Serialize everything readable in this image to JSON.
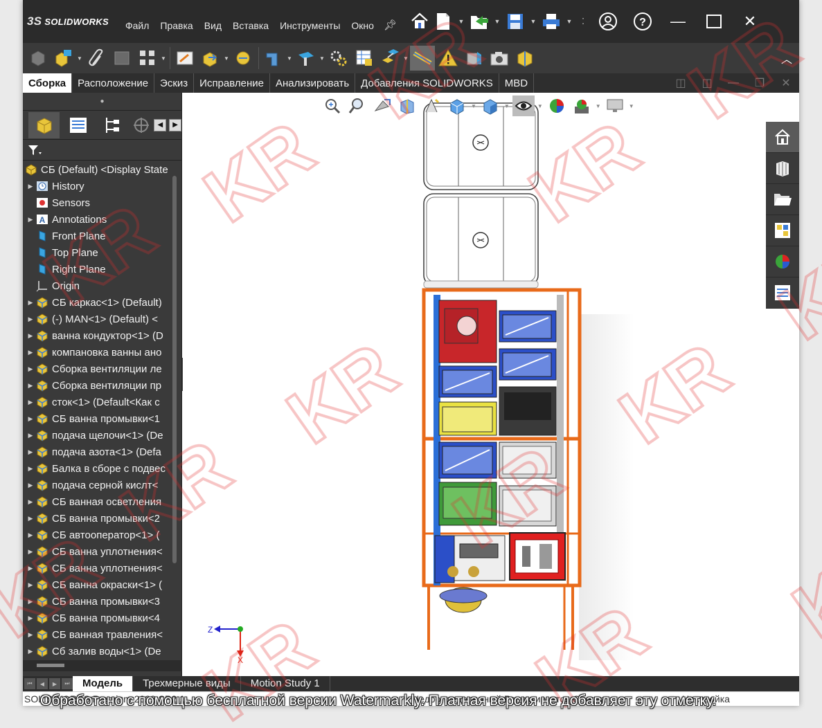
{
  "app": {
    "logo_text": "SOLIDWORKS",
    "logo_ds": "3S"
  },
  "menu": [
    "Файл",
    "Правка",
    "Вид",
    "Вставка",
    "Инструменты",
    "Окно"
  ],
  "command_tabs": [
    {
      "label": "Сборка",
      "active": true
    },
    {
      "label": "Расположение",
      "active": false
    },
    {
      "label": "Эскиз",
      "active": false
    },
    {
      "label": "Исправление",
      "active": false
    },
    {
      "label": "Анализировать",
      "active": false
    },
    {
      "label": "Добавления SOLIDWORKS",
      "active": false
    },
    {
      "label": "MBD",
      "active": false
    }
  ],
  "tree": [
    {
      "label": "СБ (Default) <Display State",
      "icon": "assembly-icon",
      "expand": false,
      "indent": 0
    },
    {
      "label": "History",
      "icon": "history-icon",
      "expand": true,
      "indent": 1
    },
    {
      "label": "Sensors",
      "icon": "sensors-icon",
      "expand": false,
      "indent": 1
    },
    {
      "label": "Annotations",
      "icon": "annotations-icon",
      "expand": true,
      "indent": 1
    },
    {
      "label": "Front Plane",
      "icon": "plane-icon",
      "expand": false,
      "indent": 1
    },
    {
      "label": "Top Plane",
      "icon": "plane-icon",
      "expand": false,
      "indent": 1
    },
    {
      "label": "Right Plane",
      "icon": "plane-icon",
      "expand": false,
      "indent": 1
    },
    {
      "label": "Origin",
      "icon": "origin-icon",
      "expand": false,
      "indent": 1
    },
    {
      "label": "СБ каркас<1> (Default)",
      "icon": "subassembly-icon",
      "expand": true,
      "indent": 1
    },
    {
      "label": "(-) MAN<1> (Default) <",
      "icon": "subassembly-icon",
      "expand": true,
      "indent": 1
    },
    {
      "label": "ванна кондуктор<1> (D",
      "icon": "subassembly-icon",
      "expand": true,
      "indent": 1
    },
    {
      "label": "компановка ванны ано",
      "icon": "subassembly-icon",
      "expand": true,
      "indent": 1
    },
    {
      "label": "Сборка вентиляции ле",
      "icon": "subassembly-icon",
      "expand": true,
      "indent": 1
    },
    {
      "label": "Сборка вентиляции пр",
      "icon": "subassembly-icon",
      "expand": true,
      "indent": 1
    },
    {
      "label": "сток<1> (Default<Как с",
      "icon": "subassembly-icon",
      "expand": true,
      "indent": 1
    },
    {
      "label": "СБ ванна промывки<1",
      "icon": "subassembly-icon",
      "expand": true,
      "indent": 1
    },
    {
      "label": "подача щелочи<1> (De",
      "icon": "subassembly-icon",
      "expand": true,
      "indent": 1
    },
    {
      "label": "подача азота<1> (Defa",
      "icon": "subassembly-icon",
      "expand": true,
      "indent": 1
    },
    {
      "label": "Балка в сборе с подвес",
      "icon": "subassembly-icon",
      "expand": true,
      "indent": 1
    },
    {
      "label": "подача серной кислт<",
      "icon": "subassembly-icon",
      "expand": true,
      "indent": 1
    },
    {
      "label": "СБ ванная осветления",
      "icon": "subassembly-icon",
      "expand": true,
      "indent": 1
    },
    {
      "label": "СБ ванна промывки<2",
      "icon": "subassembly-icon",
      "expand": true,
      "indent": 1
    },
    {
      "label": "СБ автооператор<1> (",
      "icon": "subassembly-icon",
      "expand": true,
      "indent": 1
    },
    {
      "label": "СБ ванна уплотнения<",
      "icon": "subassembly-icon",
      "expand": true,
      "indent": 1
    },
    {
      "label": "СБ ванна уплотнения<",
      "icon": "subassembly-icon",
      "expand": true,
      "indent": 1
    },
    {
      "label": "СБ ванна окраски<1> (",
      "icon": "subassembly-icon",
      "expand": true,
      "indent": 1
    },
    {
      "label": "СБ ванна промывки<3",
      "icon": "subassembly-icon",
      "expand": true,
      "indent": 1
    },
    {
      "label": "СБ ванна промывки<4",
      "icon": "subassembly-icon",
      "expand": true,
      "indent": 1
    },
    {
      "label": "СБ ванная травления<",
      "icon": "subassembly-icon",
      "expand": true,
      "indent": 1
    },
    {
      "label": "Сб залив воды<1> (De",
      "icon": "subassembly-icon",
      "expand": true,
      "indent": 1
    }
  ],
  "bottom_tabs": [
    {
      "label": "Модель",
      "active": true
    },
    {
      "label": "Трехмерные виды",
      "active": false
    },
    {
      "label": "Motion Study 1",
      "active": false
    }
  ],
  "status": {
    "left": "SOLIDWORKS Premium 2022 SP2.1",
    "mid": "Недоопределенный   Редактируется Сборка",
    "right": "Настройка"
  },
  "triad": {
    "z": "Z",
    "x": "X"
  },
  "watermark": {
    "logo": "KR",
    "notice": "Обработано с помощью бесплатной версии Watermarkly. Платная версия не добавляет эту отметку."
  },
  "colors": {
    "frame": "#e86a1a",
    "red_tank": "#c8262a",
    "blue_tank": "#2b4fc8",
    "yellow_tank": "#e9e142",
    "green_tank": "#3f9a3a",
    "dark_tank": "#3a3a3a",
    "grey_tank": "#d8d8d8"
  }
}
